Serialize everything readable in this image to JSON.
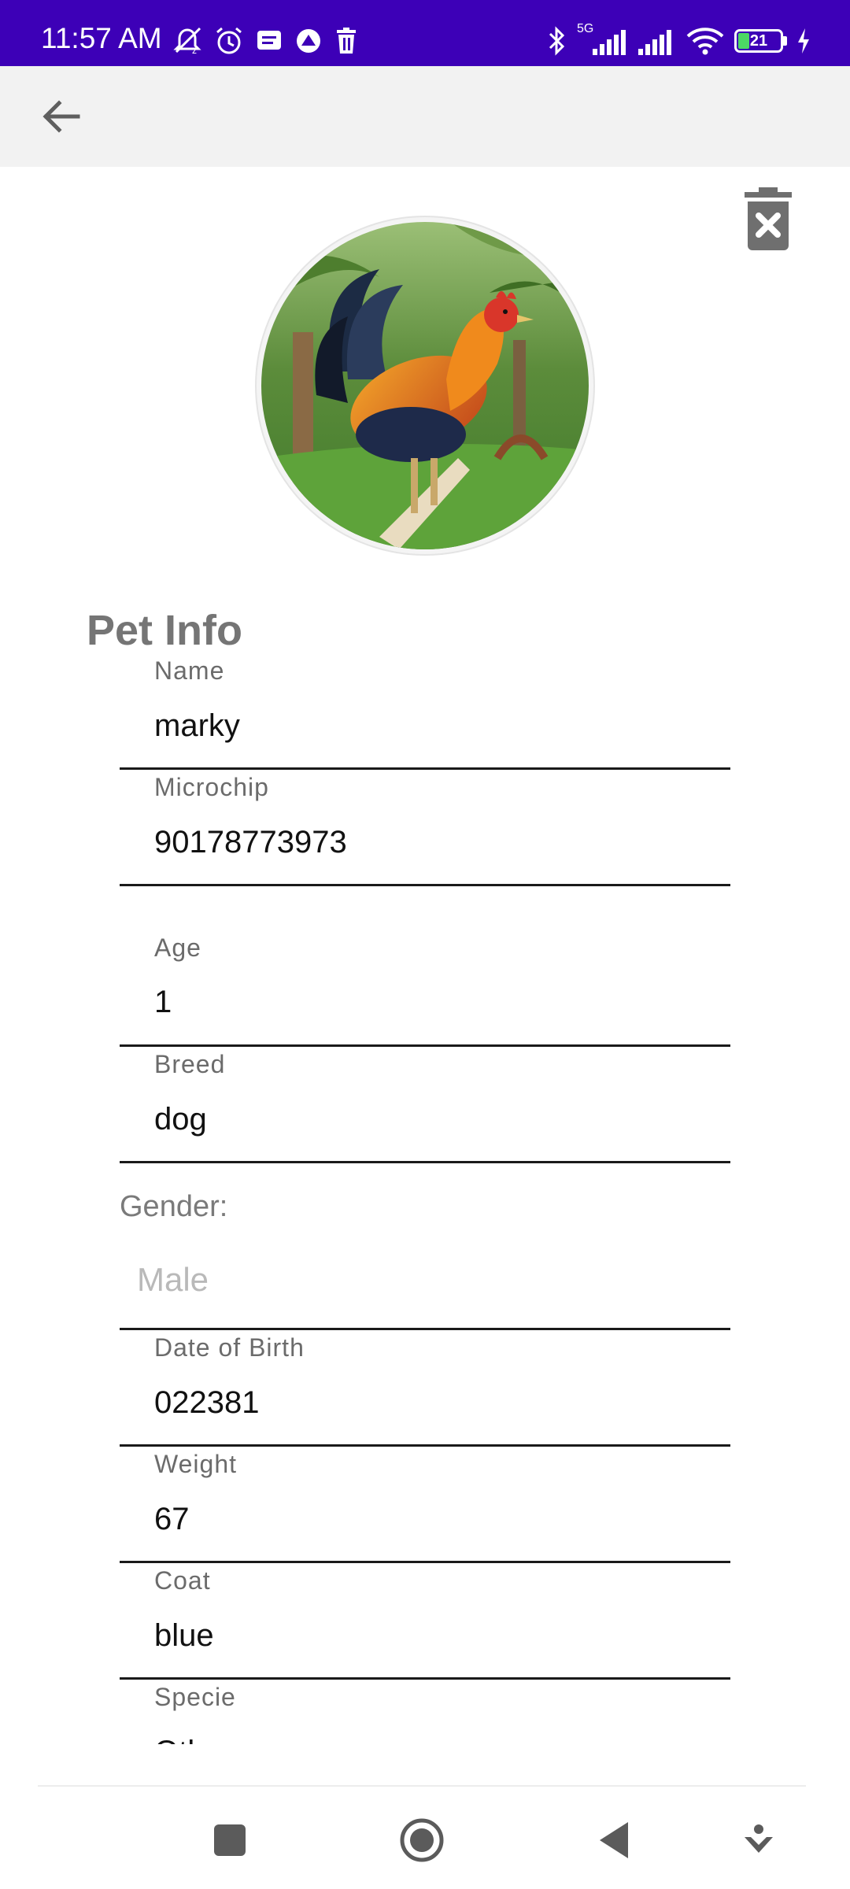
{
  "status_bar": {
    "time": "11:57 AM",
    "battery": "21",
    "network": "5G",
    "icons_left": [
      "mute-icon",
      "alarm-icon",
      "message-icon",
      "vpn-icon",
      "trash-icon"
    ],
    "icons_right": [
      "bluetooth-icon",
      "signal-icon",
      "signal-icon",
      "wifi-icon",
      "battery-icon",
      "charging-icon"
    ]
  },
  "app_bar": {
    "back_icon": "arrow-left-icon"
  },
  "actions": {
    "delete_icon": "delete-x-icon"
  },
  "avatar": {
    "subject": "rooster-photo"
  },
  "section_title": "Pet Info",
  "fields": [
    {
      "label": "Name",
      "value": "marky"
    },
    {
      "label": "Microchip",
      "value": "90178773973"
    },
    {
      "label": "Age",
      "value": "1"
    },
    {
      "label": "Breed",
      "value": "dog"
    },
    {
      "label": "Date of Birth",
      "value": "022381"
    },
    {
      "label": "Weight",
      "value": "67"
    },
    {
      "label": "Coat",
      "value": "blue"
    },
    {
      "label": "Specie",
      "value": "Other"
    }
  ],
  "gender": {
    "label": "Gender:",
    "value": "Male"
  },
  "nav": {
    "buttons": [
      "recents-icon",
      "home-icon",
      "back-icon",
      "assistant-icon"
    ]
  },
  "colors": {
    "status_bar": "#3d00b7",
    "app_bar": "#f2f2f2",
    "title": "#757575",
    "underline": "#1a1a1a"
  }
}
